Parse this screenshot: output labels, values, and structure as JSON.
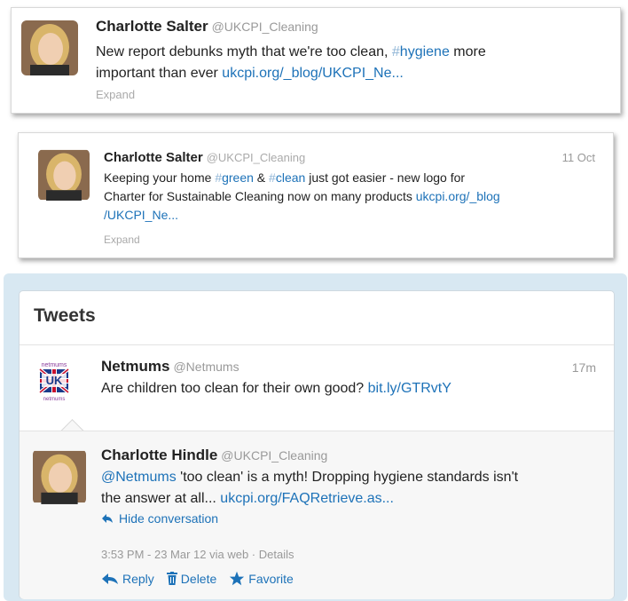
{
  "tweet1": {
    "name": "Charlotte Salter",
    "handle": "@UKCPI_Cleaning",
    "text_a": "New report debunks myth that we're too clean, ",
    "hashtag_sym": "#",
    "hashtag_word": "hygiene",
    "text_b": " more",
    "text_c": "important than ever ",
    "link": "ukcpi.org/_blog/UKCPI_Ne...",
    "expand": "Expand"
  },
  "tweet2": {
    "name": "Charlotte Salter",
    "handle": "@UKCPI_Cleaning",
    "time": "11 Oct",
    "text_a": "Keeping your home ",
    "tag1_sym": "#",
    "tag1_word": "green",
    "amp": " & ",
    "tag2_sym": "#",
    "tag2_word": "clean",
    "text_b": " just got easier - new logo for",
    "text_c": "Charter for Sustainable Cleaning now on many products ",
    "link_a": "ukcpi.org/_blog",
    "link_b": "/UKCPI_Ne...",
    "expand": "Expand"
  },
  "panel": {
    "title": "Tweets",
    "tweet": {
      "name": "Netmums",
      "handle": "@Netmums",
      "time": "17m",
      "text": "Are children too clean for their own good? ",
      "link": "bit.ly/GTRvtY",
      "logo_top": "netmums",
      "logo_mid": "UK",
      "logo_bottom": "netmums"
    },
    "reply": {
      "name": "Charlotte Hindle",
      "handle": "@UKCPI_Cleaning",
      "mention": "@Netmums",
      "text_a": " 'too clean' is a myth! Dropping hygiene standards isn't",
      "text_b": "the answer at all... ",
      "link": "ukcpi.org/FAQRetrieve.as...",
      "hide": "Hide conversation",
      "meta": "3:53 PM - 23 Mar 12 via web · Details",
      "actions": {
        "reply": "Reply",
        "delete": "Delete",
        "favorite": "Favorite"
      }
    }
  },
  "colors": {
    "link": "#1d72b8",
    "panel_bg": "#d8e8f2",
    "name": "#222222",
    "muted": "#999999"
  }
}
